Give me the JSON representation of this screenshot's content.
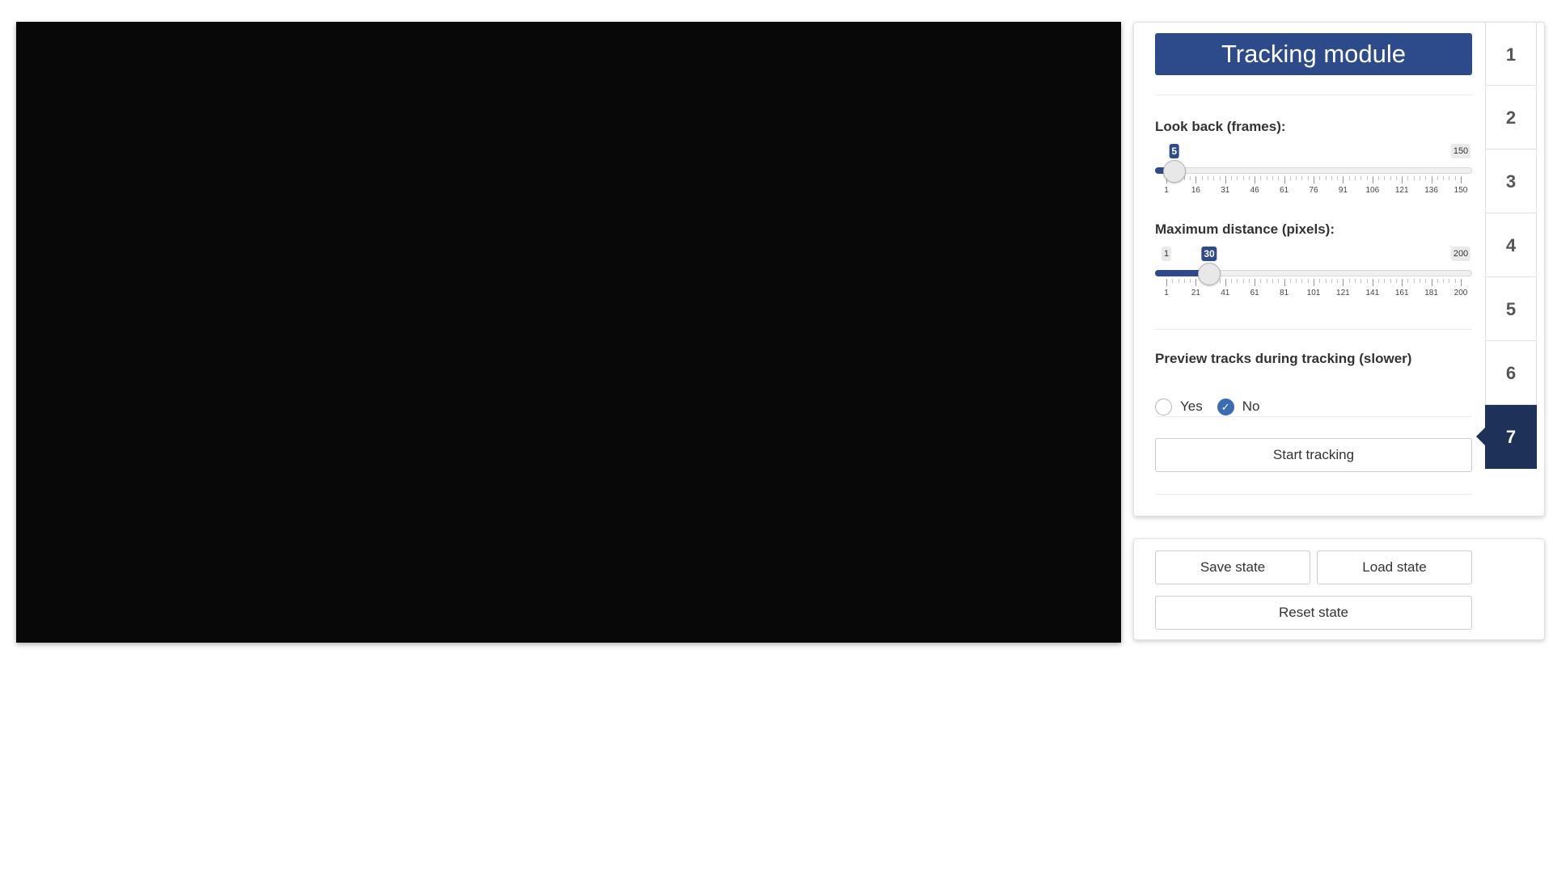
{
  "panel": {
    "title": "Tracking module",
    "lookback": {
      "label": "Look back (frames):",
      "min": 1,
      "max": 150,
      "value": 5,
      "min_label": "1",
      "max_label": "150",
      "value_label": "5",
      "ticks": [
        "1",
        "16",
        "31",
        "46",
        "61",
        "76",
        "91",
        "106",
        "121",
        "136",
        "150"
      ]
    },
    "maxdist": {
      "label": "Maximum distance (pixels):",
      "min": 1,
      "max": 200,
      "value": 30,
      "min_label": "1",
      "max_label": "200",
      "value_label": "30",
      "ticks": [
        "1",
        "21",
        "41",
        "61",
        "81",
        "101",
        "121",
        "141",
        "161",
        "181",
        "200"
      ]
    },
    "preview": {
      "label": "Preview tracks during tracking (slower)",
      "options": [
        "Yes",
        "No"
      ],
      "selected": "No"
    },
    "start_button": "Start tracking"
  },
  "state": {
    "save_label": "Save state",
    "load_label": "Load state",
    "reset_label": "Reset state"
  },
  "tabs": {
    "labels": [
      "1",
      "2",
      "3",
      "4",
      "5",
      "6",
      "7"
    ],
    "active": "7"
  },
  "colors": {
    "accent": "#2d4a8a",
    "active_tab": "#1e3158",
    "radio_checked": "#3a6db5",
    "video_bg": "#080808"
  }
}
